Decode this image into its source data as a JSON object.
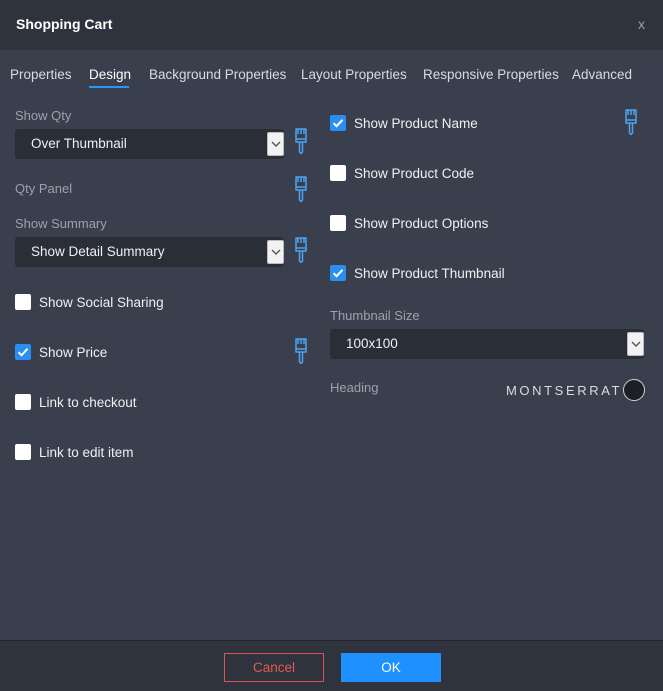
{
  "dialog": {
    "title": "Shopping Cart",
    "close_label": "x"
  },
  "tabs": [
    {
      "label": "Properties"
    },
    {
      "label": "Design",
      "active": true
    },
    {
      "label": "Background Properties"
    },
    {
      "label": "Layout Properties"
    },
    {
      "label": "Responsive Properties"
    },
    {
      "label": "Advanced"
    }
  ],
  "left": {
    "show_qty": {
      "label": "Show Qty",
      "value": "Over Thumbnail"
    },
    "qty_panel": {
      "label": "Qty Panel"
    },
    "show_summary": {
      "label": "Show Summary",
      "value": "Show Detail Summary"
    },
    "checkboxes": [
      {
        "label": "Show Social Sharing",
        "checked": false
      },
      {
        "label": "Show Price",
        "checked": true
      },
      {
        "label": "Link to checkout",
        "checked": false
      },
      {
        "label": "Link to edit item",
        "checked": false
      }
    ]
  },
  "right": {
    "checkboxes": [
      {
        "label": "Show Product Name",
        "checked": true
      },
      {
        "label": "Show Product Code",
        "checked": false
      },
      {
        "label": "Show Product Options",
        "checked": false
      },
      {
        "label": "Show Product Thumbnail",
        "checked": true
      }
    ],
    "thumbnail_size": {
      "label": "Thumbnail Size",
      "value": "100x100"
    },
    "heading": {
      "label": "Heading",
      "font": "MONTSERRAT",
      "color": "#1d1f24"
    }
  },
  "footer": {
    "cancel_label": "Cancel",
    "ok_label": "OK"
  },
  "colors": {
    "accent": "#1e90ff",
    "cancel": "#d9534f",
    "brush_icon": "#4da3f0"
  },
  "icons": {
    "brush": "paint-brush-icon",
    "caret": "chevron-down-icon",
    "check": "checkmark-icon"
  }
}
